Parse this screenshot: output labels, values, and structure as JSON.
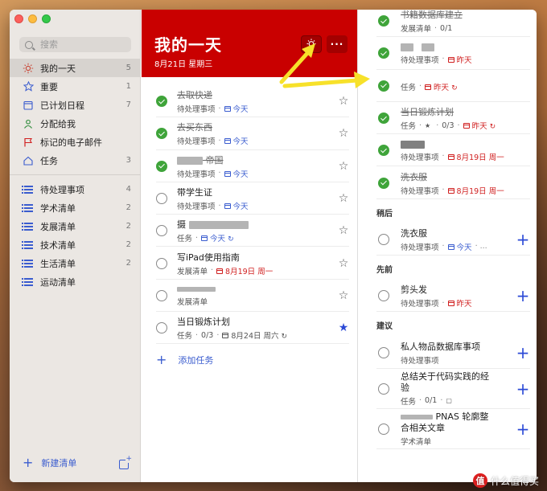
{
  "search": {
    "placeholder": "搜索"
  },
  "sidebar": {
    "smart_lists": [
      {
        "label": "我的一天",
        "count": "5",
        "icon": "sun-icon",
        "color": "#c94a3a",
        "active": true
      },
      {
        "label": "重要",
        "count": "1",
        "icon": "star-icon",
        "color": "#3a5ccf"
      },
      {
        "label": "已计划日程",
        "count": "7",
        "icon": "calendar-icon",
        "color": "#3a5ccf"
      },
      {
        "label": "分配给我",
        "count": "",
        "icon": "person-icon",
        "color": "#2e8b3a"
      },
      {
        "label": "标记的电子邮件",
        "count": "",
        "icon": "flag-icon",
        "color": "#d01f1f"
      },
      {
        "label": "任务",
        "count": "3",
        "icon": "home-icon",
        "color": "#3a5ccf"
      }
    ],
    "lists": [
      {
        "label": "待处理事项",
        "count": "4"
      },
      {
        "label": "学术清单",
        "count": "2"
      },
      {
        "label": "发展清单",
        "count": "2"
      },
      {
        "label": "技术清单",
        "count": "2"
      },
      {
        "label": "生活清单",
        "count": "2"
      },
      {
        "label": "运动清单",
        "count": ""
      }
    ],
    "new_list_label": "新建清单"
  },
  "main": {
    "title": "我的一天",
    "date": "8月21日 星期三",
    "add_task_label": "添加任务",
    "tasks": [
      {
        "title": "去取快递",
        "list": "待处理事项",
        "due": "今天",
        "done": true
      },
      {
        "title": "去买东西",
        "list": "待处理事项",
        "due": "今天",
        "done": true
      },
      {
        "title": "帝国",
        "list": "待处理事项",
        "due": "今天",
        "done": true
      },
      {
        "title": "带学生证",
        "list": "待处理事项",
        "due": "今天",
        "done": false
      },
      {
        "title": "摄",
        "list": "任务",
        "due": "今天",
        "done": false
      },
      {
        "title": "写iPad使用指南",
        "list": "发展清单",
        "due": "8月19日 周一",
        "done": false
      },
      {
        "title": "",
        "list": "发展清单",
        "due": "",
        "done": false
      },
      {
        "title": "当日锻炼计划",
        "list": "任务",
        "steps": "0/3",
        "due": "8月24日 周六",
        "done": false,
        "starred": true
      }
    ]
  },
  "right": {
    "completed": [
      {
        "title": "书籍数据库建立",
        "list": "发展清单",
        "steps": "0/1"
      },
      {
        "title": "",
        "list": "待处理事项",
        "due": "昨天"
      },
      {
        "title": "",
        "list": "任务",
        "due": "昨天"
      },
      {
        "title": "当日锻炼计划",
        "list": "任务",
        "steps": "0/3",
        "due": "昨天"
      },
      {
        "title": "",
        "list": "待处理事项",
        "due": "8月19日 周一"
      },
      {
        "title": "洗衣服",
        "list": "待处理事项",
        "due": "8月19日 周一"
      }
    ],
    "sections": [
      {
        "title": "稍后",
        "items": [
          {
            "title": "洗衣服",
            "list": "待处理事项",
            "due": "今天"
          }
        ]
      },
      {
        "title": "先前",
        "items": [
          {
            "title": "剪头发",
            "list": "待处理事项",
            "due": "昨天"
          }
        ]
      },
      {
        "title": "建议",
        "items": [
          {
            "title": "私人物品数据库事项",
            "list": "待处理事项"
          },
          {
            "title": "总结关于代码实践的经验",
            "list": "任务",
            "steps": "0/1"
          },
          {
            "title": "PNAS 轮廓整合相关文章",
            "list": "学术清单"
          }
        ]
      }
    ]
  },
  "watermark": {
    "badge": "值",
    "text": "什么值得买"
  },
  "colors": {
    "header_red": "#c90000",
    "accent_blue": "#3a5ccf",
    "done_green": "#3fa43a",
    "arrow_yellow": "#f7e12a"
  }
}
